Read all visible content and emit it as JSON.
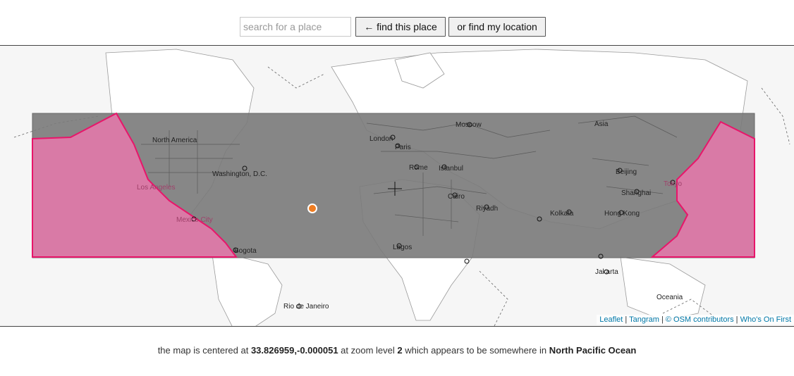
{
  "search": {
    "placeholder": "search for a place"
  },
  "buttons": {
    "find_place": "← find this place",
    "find_location": "or find my location"
  },
  "map": {
    "labels": {
      "north_america": "North America",
      "washington": "Washington, D.C.",
      "los_angeles": "Los Angeles",
      "mexico_city": "Mexico City",
      "bogota": "Bogota",
      "rio": "Rio de Janeiro",
      "london": "London",
      "paris": "Paris",
      "moscow": "Moscow",
      "rome": "Rome",
      "istanbul": "Istanbul",
      "cairo": "Cairo",
      "riyadh": "Riyadh",
      "lagos": "Lagos",
      "asia": "Asia",
      "beijing": "Beijing",
      "shanghai": "Shanghai",
      "tokyo": "Tokyo",
      "hong_kong": "Hong Kong",
      "kolkata": "Kolkata",
      "jakarta": "Jakarta",
      "oceania": "Oceania"
    },
    "attribution": {
      "leaflet": "Leaflet",
      "sep1": " | ",
      "tangram": "Tangram",
      "sep2": " | ",
      "osm": "© OSM contributors",
      "sep3": " | ",
      "wof": "Who's On First"
    },
    "colors": {
      "bbox_fill": "#7a7a7a",
      "ocean_fill": "#d97aa6",
      "ocean_stroke": "#e8156a",
      "marker": "#ef7d22"
    }
  },
  "status": {
    "prefix": "the map is centered at ",
    "coords": "33.826959,-0.000051",
    "zoom_text": " at zoom level ",
    "zoom": "2",
    "suffix": " which appears to be somewhere in ",
    "place": "North Pacific Ocean"
  }
}
